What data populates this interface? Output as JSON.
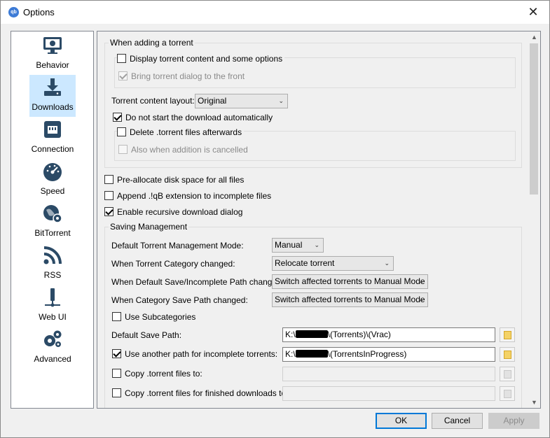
{
  "window": {
    "title": "Options",
    "app_icon": "qb"
  },
  "sidebar": {
    "items": [
      {
        "label": "Behavior",
        "icon": "monitor-icon"
      },
      {
        "label": "Downloads",
        "icon": "download-icon",
        "selected": true
      },
      {
        "label": "Connection",
        "icon": "network-icon"
      },
      {
        "label": "Speed",
        "icon": "speedometer-icon"
      },
      {
        "label": "BitTorrent",
        "icon": "globe-gear-icon"
      },
      {
        "label": "RSS",
        "icon": "rss-icon"
      },
      {
        "label": "Web UI",
        "icon": "webui-icon"
      },
      {
        "label": "Advanced",
        "icon": "gears-icon"
      }
    ]
  },
  "adding": {
    "title": "When adding a torrent",
    "display_content": "Display torrent content and some options",
    "bring_front": "Bring torrent dialog to the front",
    "layout_label": "Torrent content layout:",
    "layout_value": "Original",
    "dont_start": "Do not start the download automatically",
    "delete_files": "Delete .torrent files afterwards",
    "also_cancelled": "Also when addition is cancelled"
  },
  "general": {
    "preallocate": "Pre-allocate disk space for all files",
    "append_ext": "Append .!qB extension to incomplete files",
    "recursive": "Enable recursive download dialog"
  },
  "saving": {
    "title": "Saving Management",
    "mode_label": "Default Torrent Management Mode:",
    "mode_value": "Manual",
    "category_label": "When Torrent Category changed:",
    "category_value": "Relocate torrent",
    "default_path_changed_label": "When Default Save/Incomplete Path changed:",
    "default_path_changed_value": "Switch affected torrents to Manual Mode",
    "category_path_label": "When Category Save Path changed:",
    "category_path_value": "Switch affected torrents to Manual Mode",
    "subcategories": "Use Subcategories",
    "default_save_label": "Default Save Path:",
    "default_save_prefix": "K:\\",
    "default_save_suffix": "\\(Torrents)\\(Vrac)",
    "incomplete_label": "Use another path for incomplete torrents:",
    "incomplete_prefix": "K:\\",
    "incomplete_suffix": "\\(TorrentsInProgress)",
    "copy_to_label": "Copy .torrent files to:",
    "copy_finished_label": "Copy .torrent files for finished downloads to:"
  },
  "buttons": {
    "ok": "OK",
    "cancel": "Cancel",
    "apply": "Apply"
  }
}
